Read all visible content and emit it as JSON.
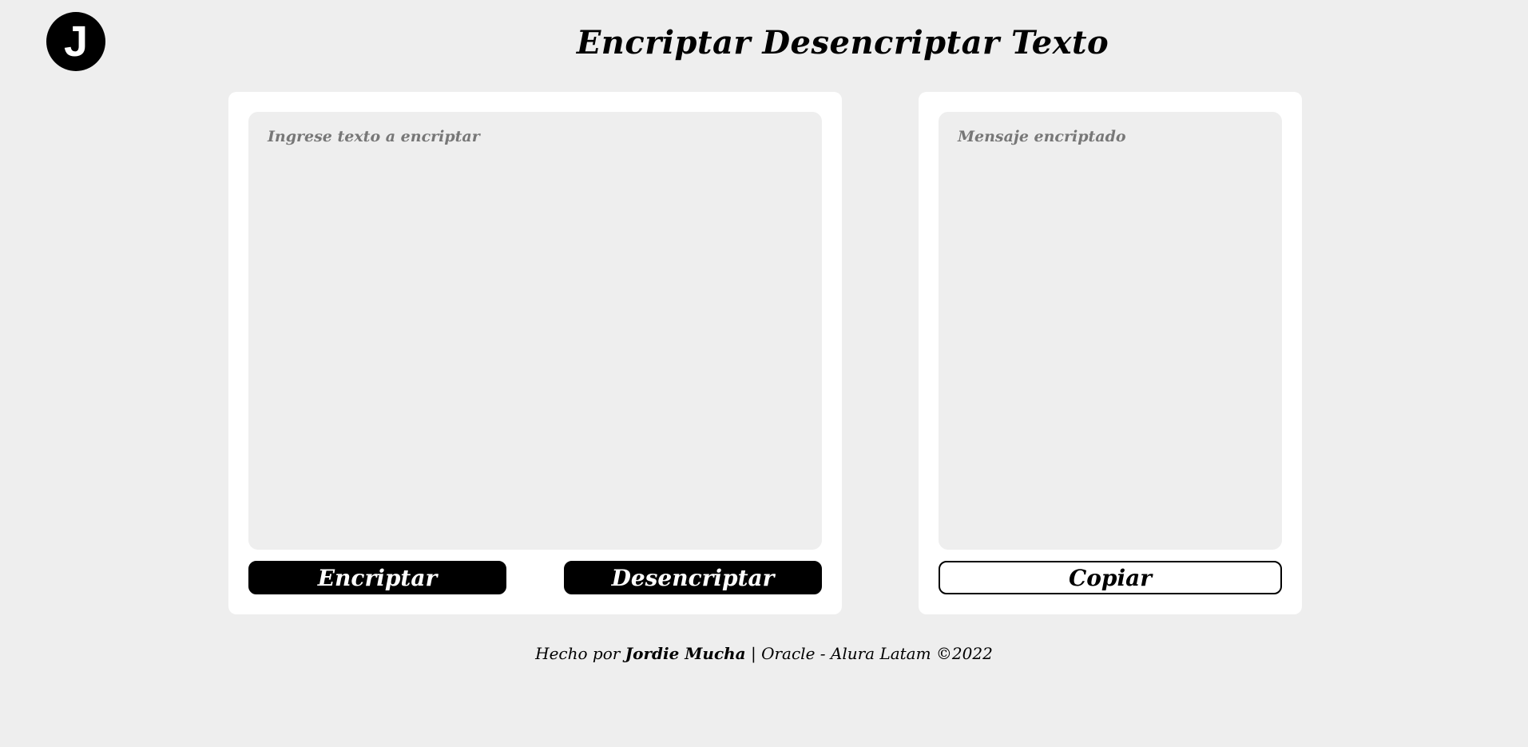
{
  "logo": {
    "letter": "J"
  },
  "header": {
    "title": "Encriptar Desencriptar Texto"
  },
  "input_panel": {
    "placeholder": "Ingrese texto a encriptar",
    "encrypt_label": "Encriptar",
    "decrypt_label": "Desencriptar"
  },
  "output_panel": {
    "placeholder": "Mensaje encriptado",
    "copy_label": "Copiar"
  },
  "footer": {
    "prefix": "Hecho por ",
    "author": "Jordie Mucha",
    "suffix": " | Oracle - Alura Latam ©2022"
  }
}
